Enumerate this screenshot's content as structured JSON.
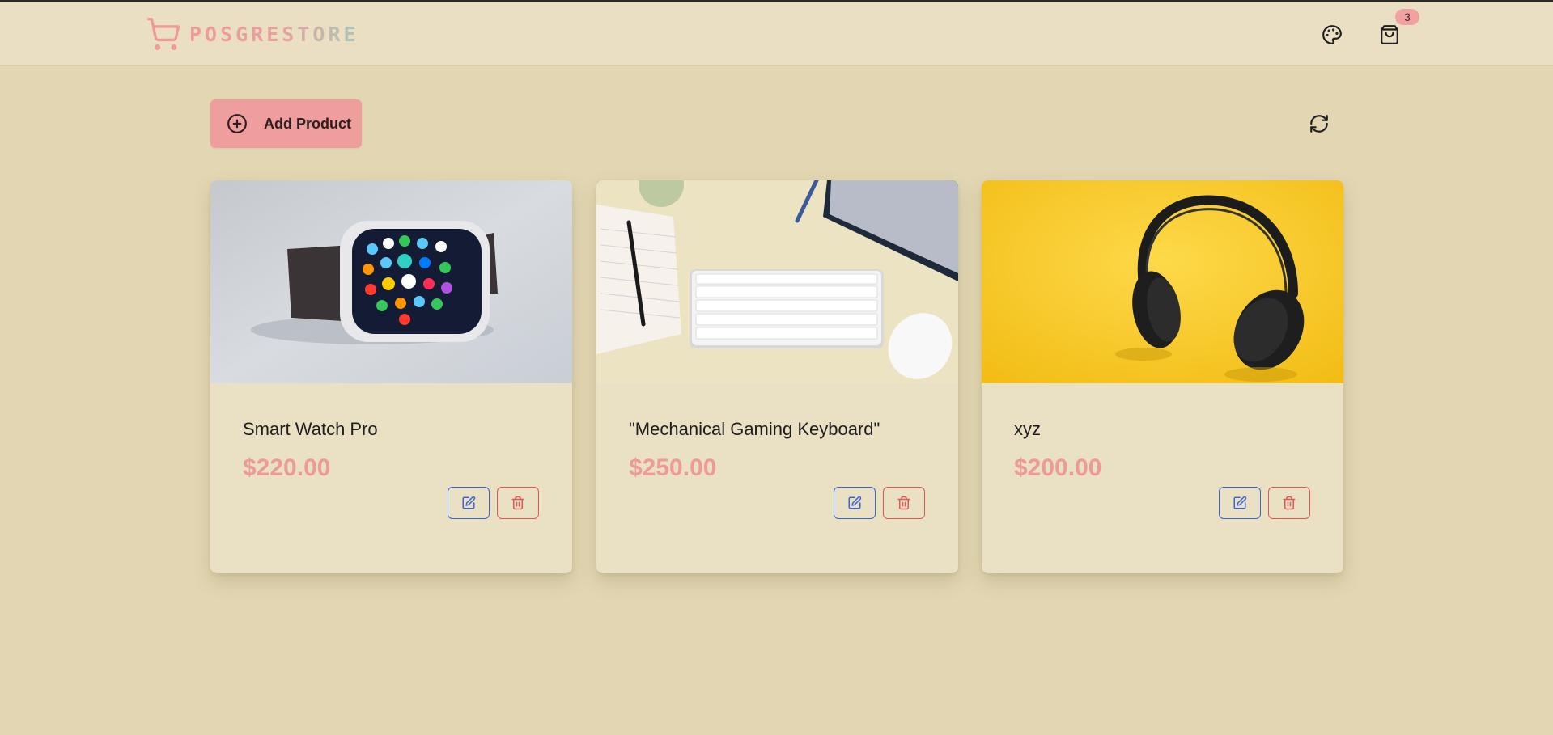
{
  "header": {
    "brand": "POSGRESTORE",
    "cart_count": "3",
    "icons": {
      "logo": "shopping-cart-icon",
      "theme": "palette-icon",
      "cart": "shopping-bag-icon"
    }
  },
  "toolbar": {
    "add_label": "Add Product",
    "add_icon": "plus-circle-icon",
    "refresh_icon": "refresh-icon"
  },
  "products": [
    {
      "name": "Smart Watch Pro",
      "price": "$220.00",
      "image": "smartwatch-photo"
    },
    {
      "name": "\"Mechanical Gaming Keyboard\"",
      "price": "$250.00",
      "image": "keyboard-desk-photo"
    },
    {
      "name": "xyz",
      "price": "$200.00",
      "image": "headphones-yellow-photo"
    }
  ],
  "colors": {
    "page_bg": "#e2d7b2",
    "header_bg": "#eadfc3",
    "card_bg": "#eae0c4",
    "accent": "#ef9e9e",
    "edit": "#3a63d8",
    "delete": "#e05555"
  }
}
